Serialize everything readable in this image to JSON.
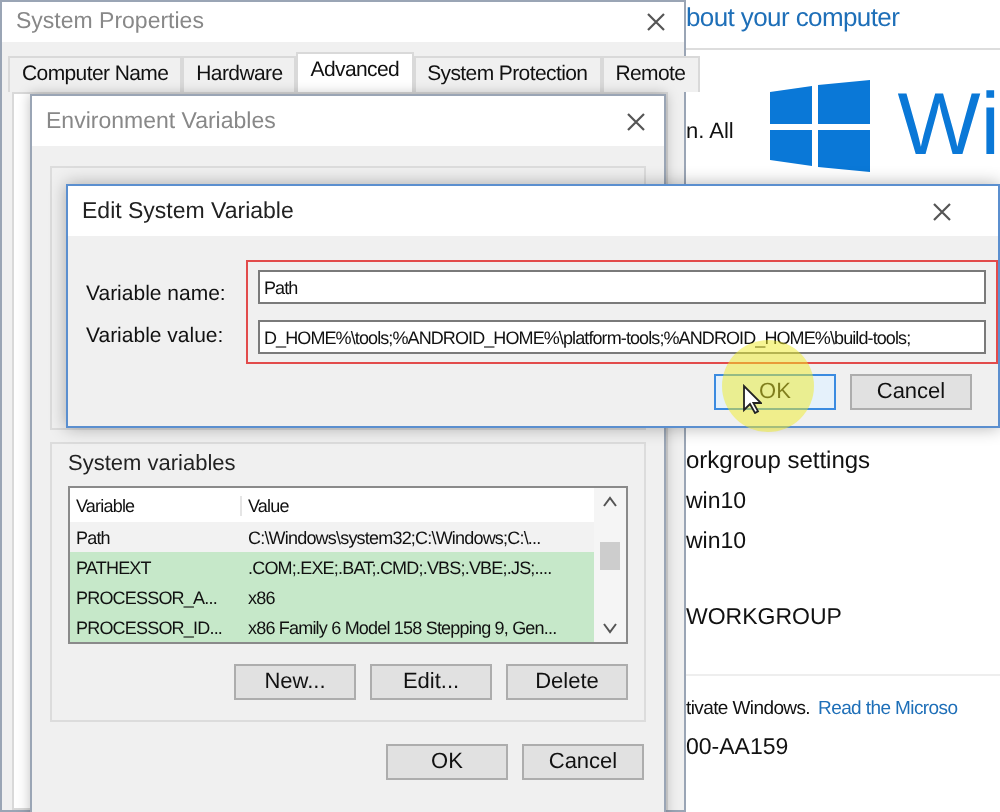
{
  "background_window": {
    "heading": "bout your computer",
    "text_1": "n. All",
    "brand": "Wi",
    "section_title": "orkgroup settings",
    "values": [
      "win10",
      "win10",
      "WORKGROUP"
    ],
    "activation_text": "tivate Windows.",
    "activation_link": "Read the Microso",
    "product_id": "00-AA159"
  },
  "system_properties": {
    "title": "System Properties",
    "tabs": [
      {
        "label": "Computer Name",
        "selected": false
      },
      {
        "label": "Hardware",
        "selected": false
      },
      {
        "label": "Advanced",
        "selected": true
      },
      {
        "label": "System Protection",
        "selected": false
      },
      {
        "label": "Remote",
        "selected": false
      }
    ]
  },
  "environment_variables": {
    "title": "Environment Variables",
    "system_variables": {
      "label": "System variables",
      "columns": [
        "Variable",
        "Value"
      ],
      "rows": [
        {
          "variable": "Path",
          "value": "C:\\Windows\\system32;C:\\Windows;C:\\...",
          "selected": false
        },
        {
          "variable": "PATHEXT",
          "value": ".COM;.EXE;.BAT;.CMD;.VBS;.VBE;.JS;....",
          "selected": true
        },
        {
          "variable": "PROCESSOR_A...",
          "value": "x86",
          "selected": true
        },
        {
          "variable": "PROCESSOR_ID...",
          "value": "x86 Family 6 Model 158 Stepping 9, Gen...",
          "selected": true
        }
      ]
    },
    "list_buttons": [
      "New...",
      "Edit...",
      "Delete"
    ],
    "buttons": [
      "OK",
      "Cancel"
    ]
  },
  "edit_dialog": {
    "title": "Edit System Variable",
    "fields": [
      {
        "label": "Variable name:",
        "value": "Path"
      },
      {
        "label": "Variable value:",
        "value": "D_HOME%\\tools;%ANDROID_HOME%\\platform-tools;%ANDROID_HOME%\\build-tools;"
      }
    ],
    "buttons": [
      "OK",
      "Cancel"
    ]
  }
}
